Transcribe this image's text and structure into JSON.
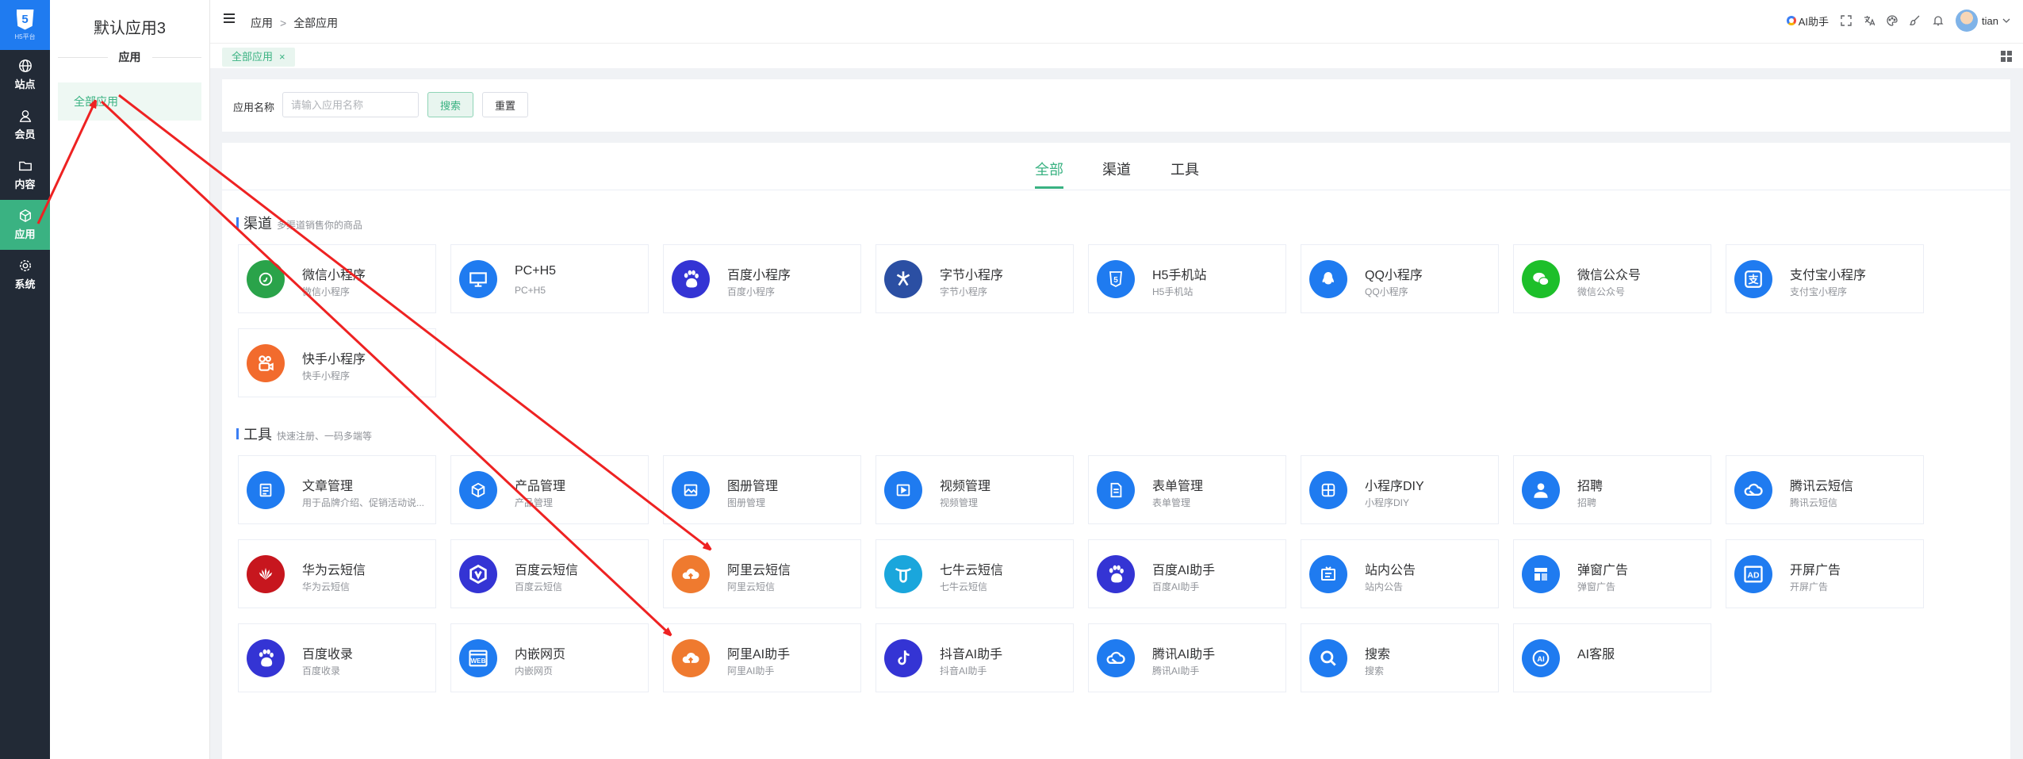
{
  "rail": {
    "logo_caption": "H5平台",
    "items": [
      {
        "label": "站点",
        "icon": "globe-icon"
      },
      {
        "label": "会员",
        "icon": "user-icon"
      },
      {
        "label": "内容",
        "icon": "folder-icon"
      },
      {
        "label": "应用",
        "icon": "cube-icon",
        "active": true
      },
      {
        "label": "系统",
        "icon": "gear-icon"
      }
    ]
  },
  "submenu": {
    "title": "默认应用3",
    "group": "应用",
    "item": "全部应用"
  },
  "header": {
    "breadcrumb": [
      "应用",
      "全部应用"
    ],
    "breadcrumb_sep": ">",
    "ai_label": "AI助手",
    "username": "tian"
  },
  "tabsbar": {
    "tab": "全部应用",
    "close": "×"
  },
  "search": {
    "label": "应用名称",
    "placeholder": "请输入应用名称",
    "value": "",
    "search_btn": "搜索",
    "reset_btn": "重置"
  },
  "main_tabs": [
    "全部",
    "渠道",
    "工具"
  ],
  "sections": {
    "channel": {
      "name": "渠道",
      "desc": "多渠道销售你的商品"
    },
    "tool": {
      "name": "工具",
      "desc": "快速注册、一码多端等"
    }
  },
  "channel_cards": [
    {
      "title": "微信小程序",
      "desc": "微信小程序",
      "icon": "wechat-mini-icon",
      "color": "#2aa34a"
    },
    {
      "title": "PC+H5",
      "desc": "PC+H5",
      "icon": "monitor-icon",
      "color": "#1f7bf0"
    },
    {
      "title": "百度小程序",
      "desc": "百度小程序",
      "icon": "baidu-paw-icon",
      "color": "#3434d4"
    },
    {
      "title": "字节小程序",
      "desc": "字节小程序",
      "icon": "bytedance-icon",
      "color": "#2b4fa3"
    },
    {
      "title": "H5手机站",
      "desc": "H5手机站",
      "icon": "html5-icon",
      "color": "#1f7bf0"
    },
    {
      "title": "QQ小程序",
      "desc": "QQ小程序",
      "icon": "qq-icon",
      "color": "#1f7bf0"
    },
    {
      "title": "微信公众号",
      "desc": "微信公众号",
      "icon": "wechat-icon",
      "color": "#1dbf2a"
    },
    {
      "title": "支付宝小程序",
      "desc": "支付宝小程序",
      "icon": "alipay-icon",
      "color": "#1f7bf0"
    },
    {
      "title": "快手小程序",
      "desc": "快手小程序",
      "icon": "kuaishou-icon",
      "color": "#f26b2d"
    }
  ],
  "tool_cards": [
    {
      "title": "文章管理",
      "desc": "用于品牌介绍、促销活动说...",
      "icon": "article-icon",
      "color": "#1f7bf0"
    },
    {
      "title": "产品管理",
      "desc": "产品管理",
      "icon": "product-icon",
      "color": "#1f7bf0"
    },
    {
      "title": "图册管理",
      "desc": "图册管理",
      "icon": "gallery-icon",
      "color": "#1f7bf0"
    },
    {
      "title": "视频管理",
      "desc": "视频管理",
      "icon": "video-icon",
      "color": "#1f7bf0"
    },
    {
      "title": "表单管理",
      "desc": "表单管理",
      "icon": "form-icon",
      "color": "#1f7bf0"
    },
    {
      "title": "小程序DIY",
      "desc": "小程序DIY",
      "icon": "diy-icon",
      "color": "#1f7bf0"
    },
    {
      "title": "招聘",
      "desc": "招聘",
      "icon": "recruit-icon",
      "color": "#1f7bf0"
    },
    {
      "title": "腾讯云短信",
      "desc": "腾讯云短信",
      "icon": "tencent-cloud-icon",
      "color": "#1f7bf0"
    },
    {
      "title": "华为云短信",
      "desc": "华为云短信",
      "icon": "huawei-icon",
      "color": "#c7161e"
    },
    {
      "title": "百度云短信",
      "desc": "百度云短信",
      "icon": "baidu-cloud-icon",
      "color": "#3434d4"
    },
    {
      "title": "阿里云短信",
      "desc": "阿里云短信",
      "icon": "aliyun-icon",
      "color": "#ef7a2f"
    },
    {
      "title": "七牛云短信",
      "desc": "七牛云短信",
      "icon": "qiniu-icon",
      "color": "#1aa6dc"
    },
    {
      "title": "百度AI助手",
      "desc": "百度AI助手",
      "icon": "baidu-paw-icon",
      "color": "#3434d4"
    },
    {
      "title": "站内公告",
      "desc": "站内公告",
      "icon": "notice-icon",
      "color": "#1f7bf0"
    },
    {
      "title": "弹窗广告",
      "desc": "弹窗广告",
      "icon": "popup-icon",
      "color": "#1f7bf0"
    },
    {
      "title": "开屏广告",
      "desc": "开屏广告",
      "icon": "ad-icon",
      "color": "#1f7bf0"
    },
    {
      "title": "百度收录",
      "desc": "百度收录",
      "icon": "baidu-paw-icon",
      "color": "#3434d4"
    },
    {
      "title": "内嵌网页",
      "desc": "内嵌网页",
      "icon": "web-icon",
      "color": "#1f7bf0"
    },
    {
      "title": "阿里AI助手",
      "desc": "阿里AI助手",
      "icon": "aliyun-icon",
      "color": "#ef7a2f"
    },
    {
      "title": "抖音AI助手",
      "desc": "抖音AI助手",
      "icon": "douyin-icon",
      "color": "#3434d4"
    },
    {
      "title": "腾讯AI助手",
      "desc": "腾讯AI助手",
      "icon": "tencent-cloud-icon",
      "color": "#1f7bf0"
    },
    {
      "title": "搜索",
      "desc": "搜索",
      "icon": "search-icon",
      "color": "#1f7bf0"
    },
    {
      "title": "AI客服",
      "desc": "",
      "icon": "ai-service-icon",
      "color": "#1f7bf0"
    }
  ],
  "colors": {
    "accent": "#3ab282",
    "rail_bg": "#222a36",
    "annotation": "#ee2222"
  }
}
